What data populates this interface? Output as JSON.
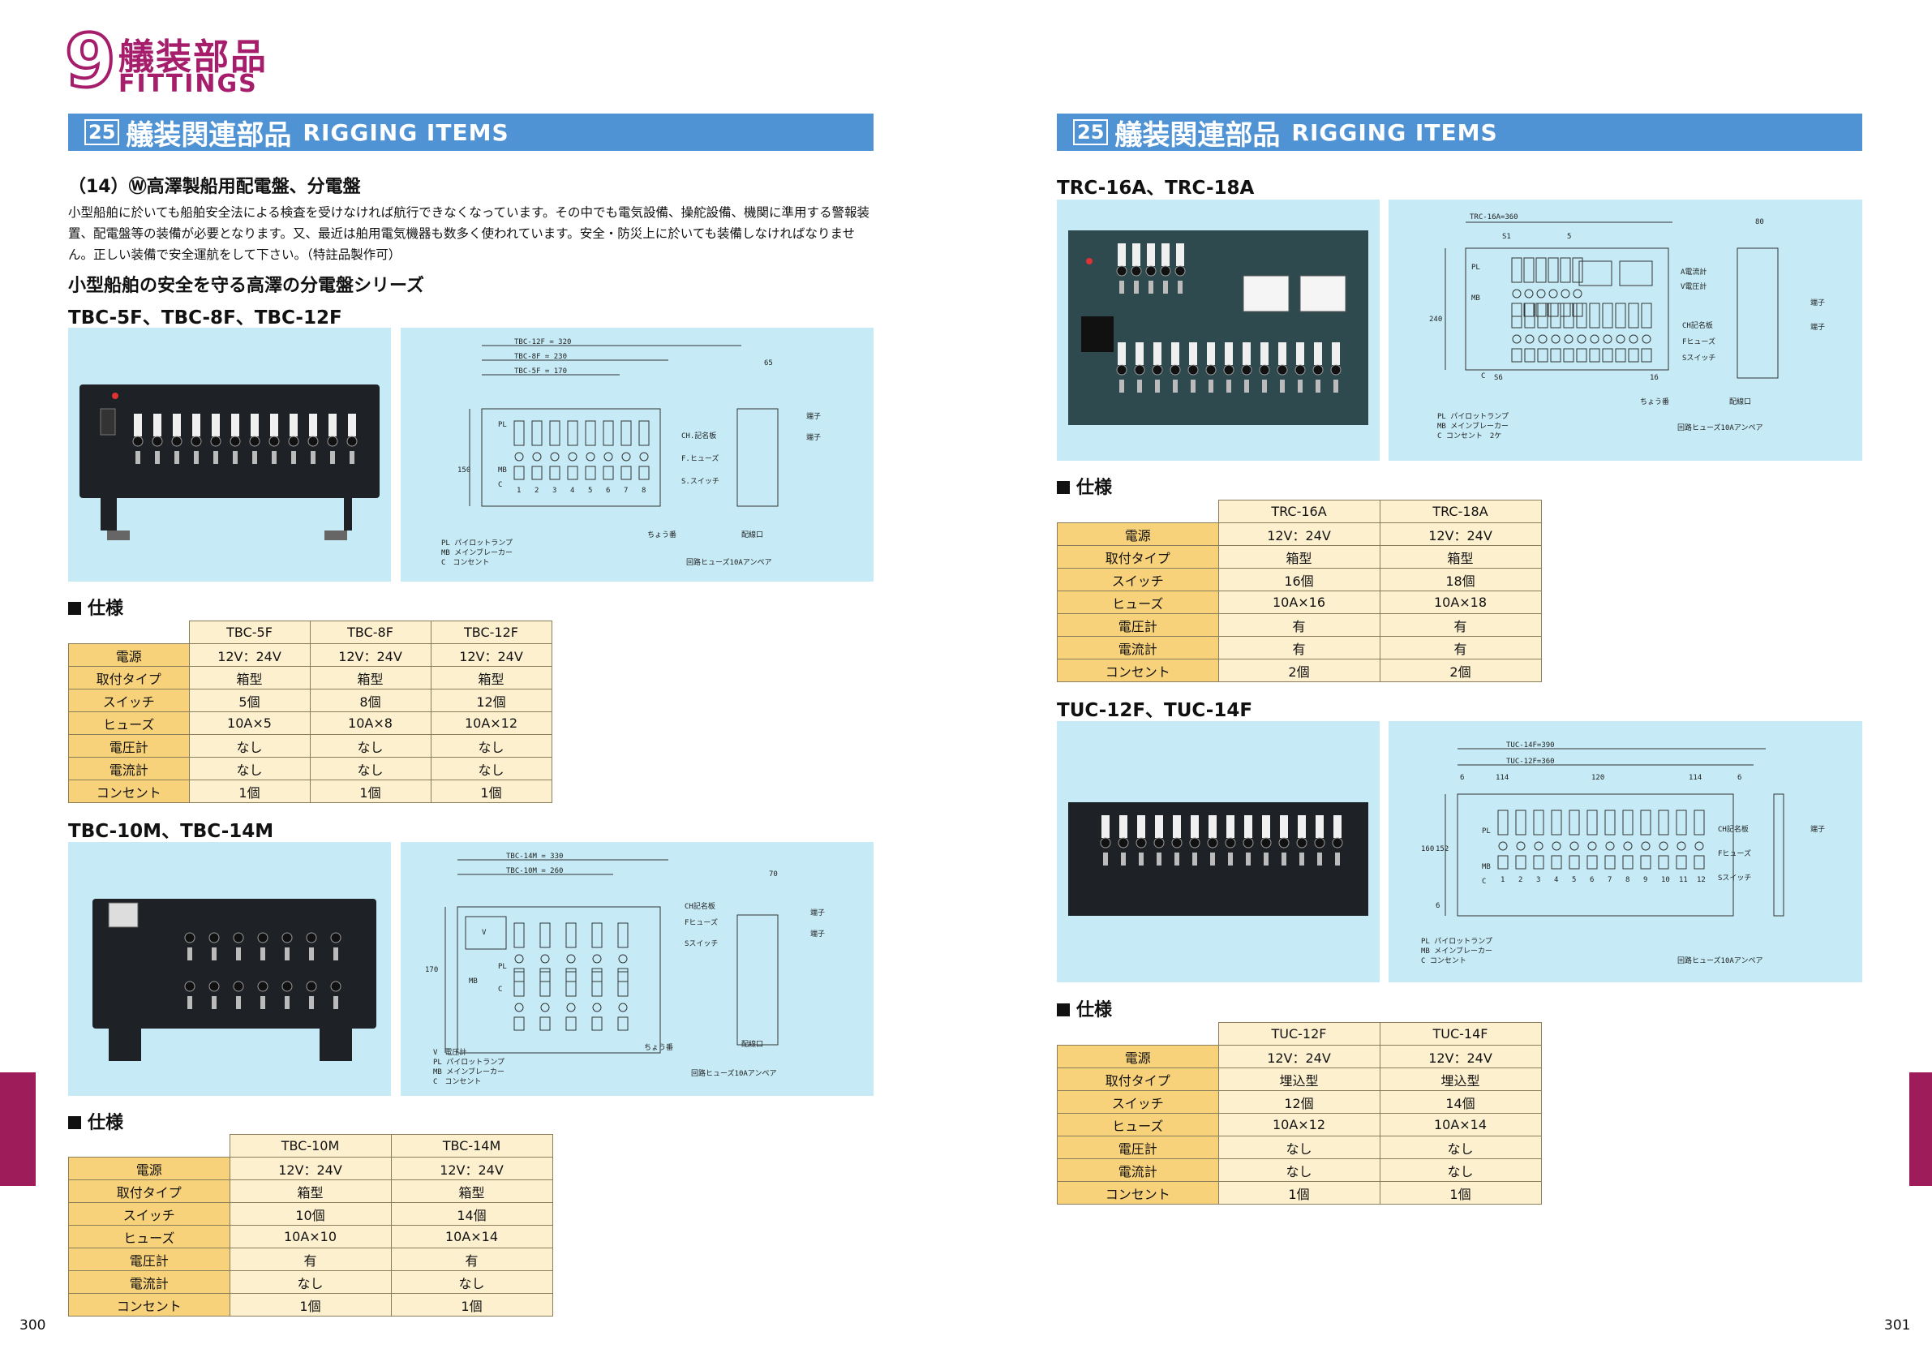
{
  "chapter": {
    "number": "9",
    "title_ja": "艤装部品",
    "title_en": "FITTINGS"
  },
  "section_bar": {
    "number": "25",
    "title_ja": "艤装関連部品",
    "title_en": "RIGGING ITEMS"
  },
  "left": {
    "subheading": "（14）Ⓦ高澤製船用配電盤、分電盤",
    "intro": "小型船舶に於いても船舶安全法による検査を受けなければ航行できなくなっています。その中でも電気設備、操舵設備、機関に準用する警報装置、配電盤等の装備が必要となります。又、最近は舶用電気機器も数多く使われています。安全・防災上に於いても装備しなければなりません。正しい装備で安全運航をして下さい。（特註品製作可）",
    "series_heading": "小型船舶の安全を守る高澤の分電盤シリーズ",
    "group1": {
      "model_heading": "TBC-5F、TBC-8F、TBC-12F",
      "spec_heading": "仕様",
      "columns": [
        "TBC-5F",
        "TBC-8F",
        "TBC-12F"
      ],
      "rows": [
        {
          "label": "電源",
          "values": [
            "12V：24V",
            "12V：24V",
            "12V：24V"
          ]
        },
        {
          "label": "取付タイプ",
          "values": [
            "箱型",
            "箱型",
            "箱型"
          ]
        },
        {
          "label": "スイッチ",
          "values": [
            "5個",
            "8個",
            "12個"
          ]
        },
        {
          "label": "ヒューズ",
          "values": [
            "10A×5",
            "10A×8",
            "10A×12"
          ]
        },
        {
          "label": "電圧計",
          "values": [
            "なし",
            "なし",
            "なし"
          ]
        },
        {
          "label": "電流計",
          "values": [
            "なし",
            "なし",
            "なし"
          ]
        },
        {
          "label": "コンセント",
          "values": [
            "1個",
            "1個",
            "1個"
          ]
        }
      ],
      "drawing": {
        "dims": [
          "TBC-12F = 320",
          "TBC-8F = 230",
          "TBC-5F = 170",
          "65",
          "150"
        ],
        "labels": [
          "CH.記名板",
          "F.ヒューズ",
          "S.スイッチ",
          "端子",
          "端子",
          "ちょう番",
          "配線口",
          "PL",
          "MB",
          "C"
        ],
        "legend": [
          "PL パイロットランプ",
          "MB メインブレーカー",
          "C　コンセント"
        ],
        "fuse_note": "回路ヒューズ10Aアンペア",
        "numbers": [
          "1",
          "2",
          "3",
          "4",
          "5",
          "6",
          "7",
          "8"
        ]
      }
    },
    "group2": {
      "model_heading": "TBC-10M、TBC-14M",
      "spec_heading": "仕様",
      "columns": [
        "TBC-10M",
        "TBC-14M"
      ],
      "rows": [
        {
          "label": "電源",
          "values": [
            "12V：24V",
            "12V：24V"
          ]
        },
        {
          "label": "取付タイプ",
          "values": [
            "箱型",
            "箱型"
          ]
        },
        {
          "label": "スイッチ",
          "values": [
            "10個",
            "14個"
          ]
        },
        {
          "label": "ヒューズ",
          "values": [
            "10A×10",
            "10A×14"
          ]
        },
        {
          "label": "電圧計",
          "values": [
            "有",
            "有"
          ]
        },
        {
          "label": "電流計",
          "values": [
            "なし",
            "なし"
          ]
        },
        {
          "label": "コンセント",
          "values": [
            "1個",
            "1個"
          ]
        }
      ],
      "drawing": {
        "dims": [
          "TBC-14M = 330",
          "TBC-10M = 260",
          "70",
          "170"
        ],
        "labels": [
          "CH記名板",
          "Fヒューズ",
          "Sスイッチ",
          "端子",
          "端子",
          "ちょう番",
          "配線口",
          "V",
          "PL",
          "MB",
          "C"
        ],
        "legend": [
          "V　電圧計",
          "PL パイロットランプ",
          "MB メインブレーカー",
          "C　コンセント"
        ],
        "fuse_note": "回路ヒューズ10Aアンペア"
      }
    }
  },
  "right": {
    "group1": {
      "model_heading": "TRC-16A、TRC-18A",
      "spec_heading": "仕様",
      "columns": [
        "TRC-16A",
        "TRC-18A"
      ],
      "rows": [
        {
          "label": "電源",
          "values": [
            "12V：24V",
            "12V：24V"
          ]
        },
        {
          "label": "取付タイプ",
          "values": [
            "箱型",
            "箱型"
          ]
        },
        {
          "label": "スイッチ",
          "values": [
            "16個",
            "18個"
          ]
        },
        {
          "label": "ヒューズ",
          "values": [
            "10A×16",
            "10A×18"
          ]
        },
        {
          "label": "電圧計",
          "values": [
            "有",
            "有"
          ]
        },
        {
          "label": "電流計",
          "values": [
            "有",
            "有"
          ]
        },
        {
          "label": "コンセント",
          "values": [
            "2個",
            "2個"
          ]
        }
      ],
      "drawing": {
        "dims": [
          "TRC-16A=360",
          "S1",
          "5",
          "80",
          "240",
          "S6",
          "16"
        ],
        "labels": [
          "A電流計",
          "V電圧計",
          "CH記名板",
          "Fヒューズ",
          "Sスイッチ",
          "端子",
          "端子",
          "ちょう番",
          "配線口",
          "PL",
          "MB",
          "C"
        ],
        "legend": [
          "PL パイロットランプ",
          "MB メインブレーカー",
          "C コンセント　2ケ"
        ],
        "fuse_note": "回路ヒューズ10Aアンペア"
      }
    },
    "group2": {
      "model_heading": "TUC-12F、TUC-14F",
      "spec_heading": "仕様",
      "columns": [
        "TUC-12F",
        "TUC-14F"
      ],
      "rows": [
        {
          "label": "電源",
          "values": [
            "12V：24V",
            "12V：24V"
          ]
        },
        {
          "label": "取付タイプ",
          "values": [
            "埋込型",
            "埋込型"
          ]
        },
        {
          "label": "スイッチ",
          "values": [
            "12個",
            "14個"
          ]
        },
        {
          "label": "ヒューズ",
          "values": [
            "10A×12",
            "10A×14"
          ]
        },
        {
          "label": "電圧計",
          "values": [
            "なし",
            "なし"
          ]
        },
        {
          "label": "電流計",
          "values": [
            "なし",
            "なし"
          ]
        },
        {
          "label": "コンセント",
          "values": [
            "1個",
            "1個"
          ]
        }
      ],
      "drawing": {
        "dims": [
          "TUC-14F=390",
          "TUC-12F=360",
          "114",
          "120",
          "114",
          "6",
          "6",
          "160",
          "152",
          "6"
        ],
        "labels": [
          "CH記名板",
          "Fヒューズ",
          "Sスイッチ",
          "端子",
          "PL",
          "MB",
          "C"
        ],
        "legend": [
          "PL パイロットランプ",
          "MB メインブレーカー",
          "C コンセント"
        ],
        "fuse_note": "回路ヒューズ10Aアンペア",
        "numbers": [
          "1",
          "2",
          "3",
          "4",
          "5",
          "6",
          "7",
          "8",
          "9",
          "10",
          "11",
          "12"
        ]
      }
    }
  },
  "page_numbers": {
    "left": "300",
    "right": "301"
  },
  "colors": {
    "accent": "#a51d6b",
    "bar": "#4f93d5",
    "panel": "#c6ebf6",
    "label_cell": "#f8d27a",
    "value_cell": "#fdf0cf",
    "side_tab": "#9e1c59"
  }
}
